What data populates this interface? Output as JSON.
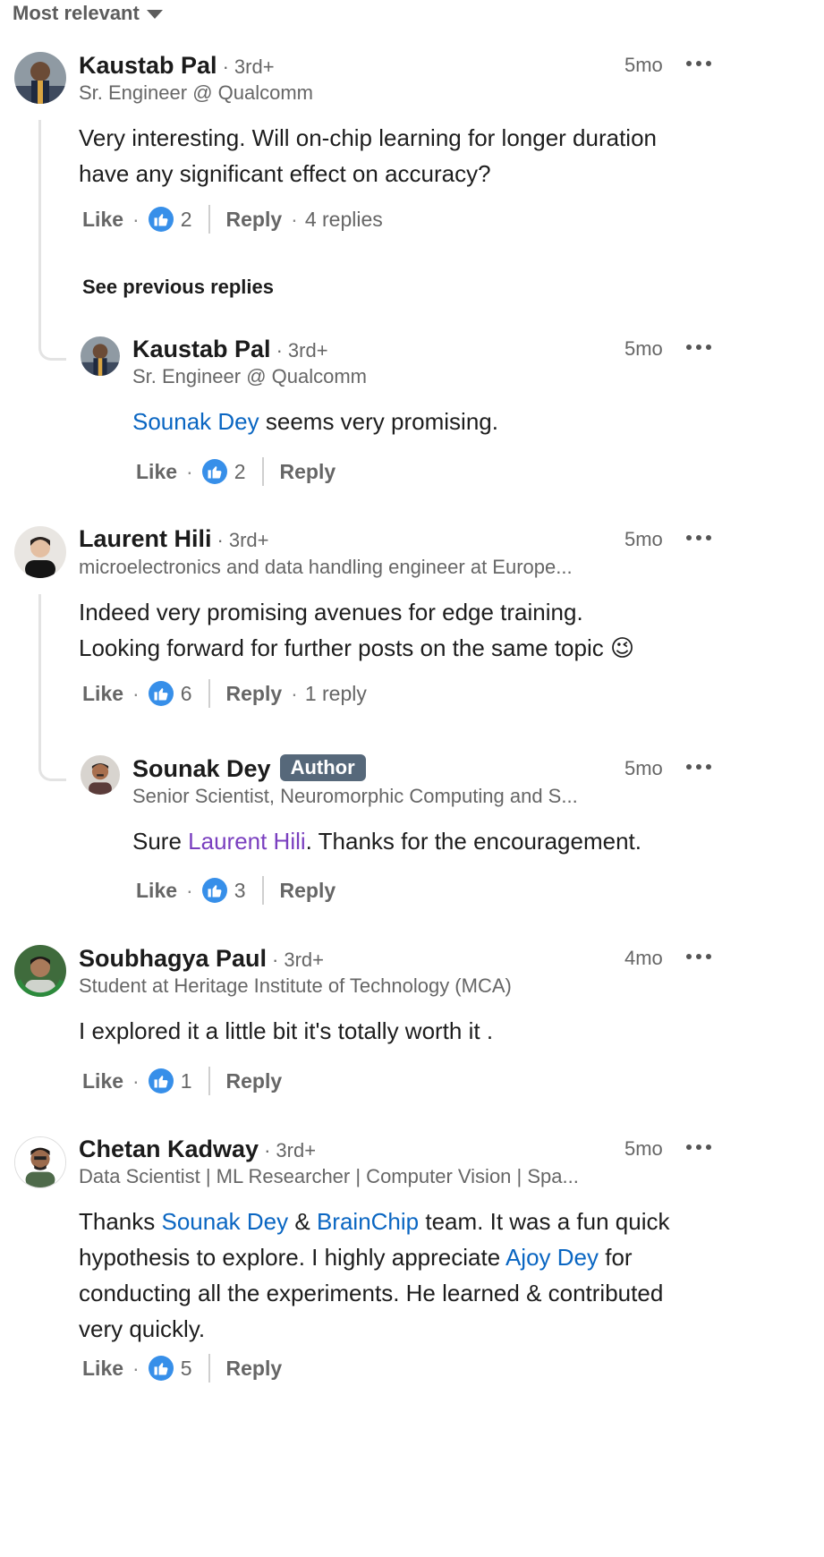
{
  "sort": {
    "label": "Most relevant"
  },
  "comments": [
    {
      "name": "Kaustab Pal",
      "degree": "3rd+",
      "headline": "Sr. Engineer @ Qualcomm",
      "time": "5mo",
      "body": "Very interesting. Will on-chip learning for longer duration have any significant effect on accuracy?",
      "like_label": "Like",
      "reactions": "2",
      "reply_label": "Reply",
      "replies": "4 replies",
      "see_previous": "See previous replies",
      "reply": {
        "name": "Kaustab Pal",
        "degree": "3rd+",
        "headline": "Sr. Engineer @ Qualcomm",
        "time": "5mo",
        "mention": "Sounak Dey",
        "body_rest": " seems very promising.",
        "like_label": "Like",
        "reactions": "2",
        "reply_label": "Reply"
      }
    },
    {
      "name": "Laurent Hili",
      "degree": "3rd+",
      "headline": "microelectronics and data handling engineer at Europe...",
      "time": "5mo",
      "body_line1": "Indeed very promising avenues for edge training.",
      "body_line2": "Looking forward for further posts on the same topic",
      "emoji": "😉",
      "like_label": "Like",
      "reactions": "6",
      "reply_label": "Reply",
      "replies": "1 reply",
      "reply": {
        "name": "Sounak Dey",
        "badge": "Author",
        "headline": "Senior Scientist, Neuromorphic Computing and S...",
        "time": "5mo",
        "body_start": "Sure ",
        "mention": "Laurent Hili",
        "body_rest": ". Thanks for the encouragement.",
        "like_label": "Like",
        "reactions": "3",
        "reply_label": "Reply"
      }
    },
    {
      "name": "Soubhagya Paul",
      "degree": "3rd+",
      "headline": "Student at Heritage Institute of Technology (MCA)",
      "time": "4mo",
      "body": "I explored it a little bit it's totally worth it .",
      "like_label": "Like",
      "reactions": "1",
      "reply_label": "Reply"
    },
    {
      "name": "Chetan Kadway",
      "degree": "3rd+",
      "headline": "Data Scientist | ML Researcher | Computer Vision | Spa...",
      "time": "5mo",
      "body_p1": "Thanks ",
      "mention1": "Sounak Dey",
      "body_p2": " & ",
      "mention2": "BrainChip",
      "body_p3": " team. It was a fun quick hypothesis to explore. I highly appreciate ",
      "mention3": "Ajoy Dey",
      "body_p4": " for conducting all the experiments. He learned & contributed very quickly.",
      "like_label": "Like",
      "reactions": "5",
      "reply_label": "Reply"
    }
  ],
  "colors": {
    "mention": "#0a66c2",
    "visited_mention": "#7a3fbf",
    "reaction": "#378fe9",
    "author_badge": "#56687a"
  },
  "icons": {
    "sort": "caret-down-icon",
    "reaction": "like-thumb-icon",
    "more": "ellipsis-icon"
  }
}
